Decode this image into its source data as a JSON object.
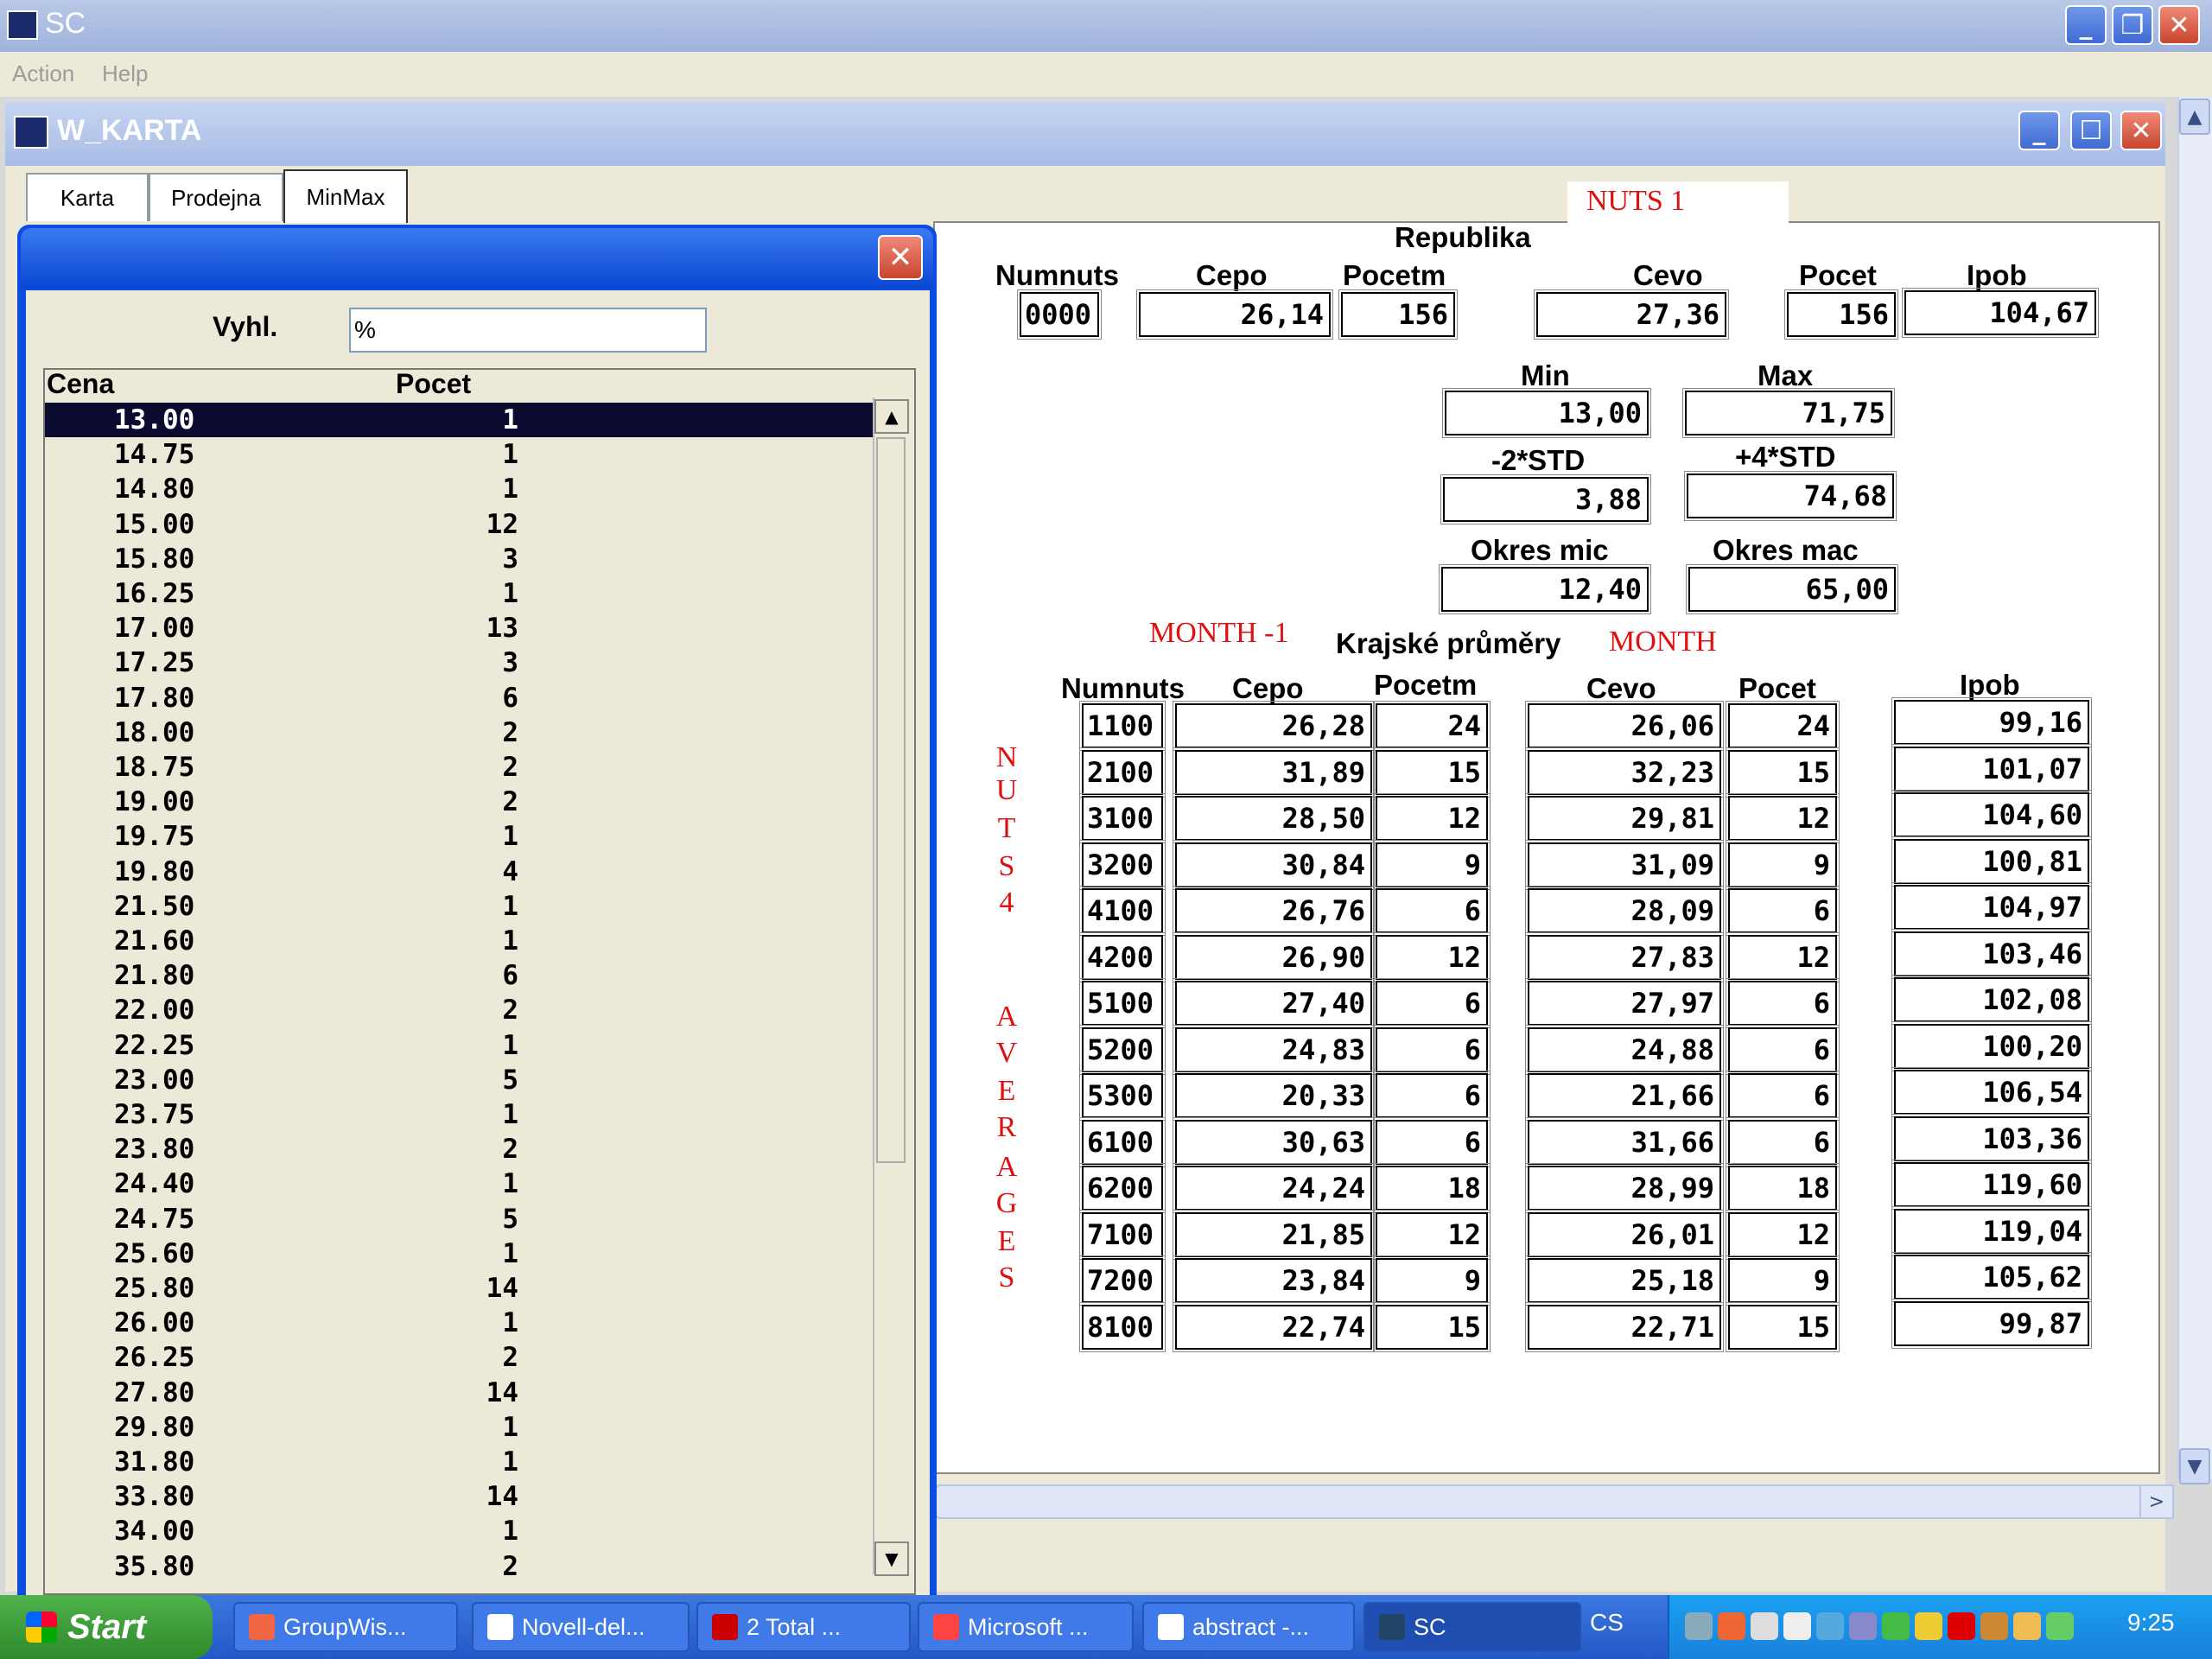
{
  "app": {
    "title": "SC"
  },
  "menu": {
    "action": "Action",
    "help": "Help"
  },
  "window": {
    "title": "W_KARTA"
  },
  "tabs": [
    "Karta",
    "Prodejna",
    "MinMax"
  ],
  "dialog": {
    "filter_label": "Vyhl.",
    "filter_value": "%",
    "list_headers": {
      "price": "Cena",
      "count": "Pocet"
    },
    "rows": [
      {
        "cena": "13.00",
        "pocet": "1"
      },
      {
        "cena": "14.75",
        "pocet": "1"
      },
      {
        "cena": "14.80",
        "pocet": "1"
      },
      {
        "cena": "15.00",
        "pocet": "12"
      },
      {
        "cena": "15.80",
        "pocet": "3"
      },
      {
        "cena": "16.25",
        "pocet": "1"
      },
      {
        "cena": "17.00",
        "pocet": "13"
      },
      {
        "cena": "17.25",
        "pocet": "3"
      },
      {
        "cena": "17.80",
        "pocet": "6"
      },
      {
        "cena": "18.00",
        "pocet": "2"
      },
      {
        "cena": "18.75",
        "pocet": "2"
      },
      {
        "cena": "19.00",
        "pocet": "2"
      },
      {
        "cena": "19.75",
        "pocet": "1"
      },
      {
        "cena": "19.80",
        "pocet": "4"
      },
      {
        "cena": "21.50",
        "pocet": "1"
      },
      {
        "cena": "21.60",
        "pocet": "1"
      },
      {
        "cena": "21.80",
        "pocet": "6"
      },
      {
        "cena": "22.00",
        "pocet": "2"
      },
      {
        "cena": "22.25",
        "pocet": "1"
      },
      {
        "cena": "23.00",
        "pocet": "5"
      },
      {
        "cena": "23.75",
        "pocet": "1"
      },
      {
        "cena": "23.80",
        "pocet": "2"
      },
      {
        "cena": "24.40",
        "pocet": "1"
      },
      {
        "cena": "24.75",
        "pocet": "5"
      },
      {
        "cena": "25.60",
        "pocet": "1"
      },
      {
        "cena": "25.80",
        "pocet": "14"
      },
      {
        "cena": "26.00",
        "pocet": "1"
      },
      {
        "cena": "26.25",
        "pocet": "2"
      },
      {
        "cena": "27.80",
        "pocet": "14"
      },
      {
        "cena": "29.80",
        "pocet": "1"
      },
      {
        "cena": "31.80",
        "pocet": "1"
      },
      {
        "cena": "33.80",
        "pocet": "14"
      },
      {
        "cena": "34.00",
        "pocet": "1"
      },
      {
        "cena": "35.80",
        "pocet": "2"
      }
    ]
  },
  "panel": {
    "nuts_label": "NUTS 1",
    "republika": "Republika",
    "headers": {
      "numnuts": "Numnuts",
      "cepo": "Cepo",
      "pocetm": "Pocetm",
      "cevo": "Cevo",
      "pocet": "Pocet",
      "ipob": "Ipob"
    },
    "rep_values": {
      "numnuts": "0000",
      "cepo": "26,14",
      "pocetm": "156",
      "cevo": "27,36",
      "pocet": "156",
      "ipob": "104,67"
    },
    "min_label": "Min",
    "max_label": "Max",
    "min_value": "13,00",
    "max_value": "71,75",
    "std_minus_label": "-2*STD",
    "std_plus_label": "+4*STD",
    "std_minus_value": "3,88",
    "std_plus_value": "74,68",
    "okres_mic_label": "Okres mic",
    "okres_mac_label": "Okres mac",
    "okres_mic_value": "12,40",
    "okres_mac_value": "65,00",
    "month_prev": "MONTH -1",
    "krajske": "Krajské průměry",
    "month": "MONTH",
    "side_letters": [
      "N",
      "U",
      "T",
      "S",
      "4",
      "A",
      "V",
      "E",
      "R",
      "A",
      "G",
      "E",
      "S"
    ],
    "regions": [
      {
        "numnuts": "1100",
        "cepo": "26,28",
        "pocetm": "24",
        "cevo": "26,06",
        "pocet": "24",
        "ipob": "99,16"
      },
      {
        "numnuts": "2100",
        "cepo": "31,89",
        "pocetm": "15",
        "cevo": "32,23",
        "pocet": "15",
        "ipob": "101,07"
      },
      {
        "numnuts": "3100",
        "cepo": "28,50",
        "pocetm": "12",
        "cevo": "29,81",
        "pocet": "12",
        "ipob": "104,60"
      },
      {
        "numnuts": "3200",
        "cepo": "30,84",
        "pocetm": "9",
        "cevo": "31,09",
        "pocet": "9",
        "ipob": "100,81"
      },
      {
        "numnuts": "4100",
        "cepo": "26,76",
        "pocetm": "6",
        "cevo": "28,09",
        "pocet": "6",
        "ipob": "104,97"
      },
      {
        "numnuts": "4200",
        "cepo": "26,90",
        "pocetm": "12",
        "cevo": "27,83",
        "pocet": "12",
        "ipob": "103,46"
      },
      {
        "numnuts": "5100",
        "cepo": "27,40",
        "pocetm": "6",
        "cevo": "27,97",
        "pocet": "6",
        "ipob": "102,08"
      },
      {
        "numnuts": "5200",
        "cepo": "24,83",
        "pocetm": "6",
        "cevo": "24,88",
        "pocet": "6",
        "ipob": "100,20"
      },
      {
        "numnuts": "5300",
        "cepo": "20,33",
        "pocetm": "6",
        "cevo": "21,66",
        "pocet": "6",
        "ipob": "106,54"
      },
      {
        "numnuts": "6100",
        "cepo": "30,63",
        "pocetm": "6",
        "cevo": "31,66",
        "pocet": "6",
        "ipob": "103,36"
      },
      {
        "numnuts": "6200",
        "cepo": "24,24",
        "pocetm": "18",
        "cevo": "28,99",
        "pocet": "18",
        "ipob": "119,60"
      },
      {
        "numnuts": "7100",
        "cepo": "21,85",
        "pocetm": "12",
        "cevo": "26,01",
        "pocet": "12",
        "ipob": "119,04"
      },
      {
        "numnuts": "7200",
        "cepo": "23,84",
        "pocetm": "9",
        "cevo": "25,18",
        "pocet": "9",
        "ipob": "105,62"
      },
      {
        "numnuts": "8100",
        "cepo": "22,74",
        "pocetm": "15",
        "cevo": "22,71",
        "pocet": "15",
        "ipob": "99,87"
      }
    ]
  },
  "taskbar": {
    "start": "Start",
    "items": [
      "GroupWis...",
      "Novell-del...",
      "2 Total ...",
      "Microsoft ...",
      "abstract -...",
      "SC"
    ],
    "lang": "CS",
    "clock": "9:25"
  }
}
